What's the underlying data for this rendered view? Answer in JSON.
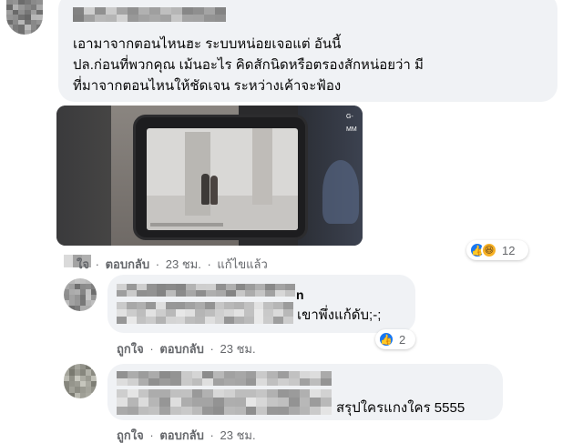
{
  "top_comment": {
    "text": "เอามาจากตอนไหนฮะ ระบบหน่อยเจอแต่ อันนี้\nปล.ก่อนที่พวกคุณ เม้นอะไร คิดสักนิดหรือตรองสักหน่อยว่า มี\nที่มาจากตอนไหนให้ชัดเจน ระหว่างเค้าจะฟ้อง",
    "video_corner_logo": "G-MM",
    "actions": {
      "like": "ใจ",
      "reply": "ตอบกลับ",
      "time": "23 ชม.",
      "edited": "แก้ไขแล้ว",
      "separator": "·"
    },
    "reactions": {
      "icons": [
        "like-icon",
        "haha-icon"
      ],
      "count": "12"
    }
  },
  "replies": [
    {
      "name_fragment": "n",
      "text": "เขาพึ่งแก้ดับ;-;",
      "actions": {
        "like": "ถูกใจ",
        "reply": "ตอบกลับ",
        "time": "23 ชม.",
        "separator": "·"
      },
      "reactions": {
        "icons": [
          "like-icon"
        ],
        "count": "2"
      }
    },
    {
      "text": "สรุปใครแกงใคร 5555",
      "actions": {
        "like": "ถูกใจ",
        "reply": "ตอบกลับ",
        "time": "23 ชม.",
        "separator": "·"
      }
    }
  ],
  "colors": {
    "bubble": "#f0f2f5",
    "meta_text": "#65676b",
    "like_blue": "#1877f2",
    "haha_yellow": "#f7b125"
  }
}
